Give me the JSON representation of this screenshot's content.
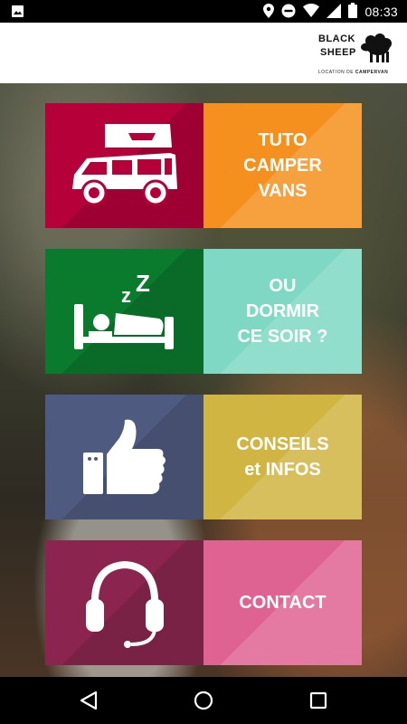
{
  "status_bar": {
    "time": "08:33",
    "icons": [
      "image-icon",
      "location-icon",
      "do-not-disturb-icon",
      "wifi-icon",
      "signal-icon",
      "battery-icon"
    ]
  },
  "header": {
    "logo_line1": "BLACK",
    "logo_line2": "SHEEP",
    "logo_sub_prefix": "LOCATION DE ",
    "logo_sub_bold": "CAMPERVAN"
  },
  "tiles": [
    {
      "id": "tuto",
      "label": "TUTO\nCAMPER\nVANS",
      "icon": "campervan-icon",
      "icon_color": "#b5003a",
      "label_color": "#f5901e"
    },
    {
      "id": "dormir",
      "label": "OU\nDORMIR\nCE SOIR ?",
      "icon": "sleeping-bed-icon",
      "icon_color": "#0a7a2c",
      "label_color": "#7fd8c4"
    },
    {
      "id": "conseils",
      "label": "CONSEILS\net INFOS",
      "icon": "thumbs-up-icon",
      "icon_color": "#4f5a80",
      "label_color": "#d1b542"
    },
    {
      "id": "contact",
      "label": "CONTACT",
      "icon": "headset-icon",
      "icon_color": "#8b2550",
      "label_color": "#df6392"
    }
  ],
  "nav_bar": {
    "buttons": [
      "back-icon",
      "home-icon",
      "recents-icon"
    ]
  }
}
